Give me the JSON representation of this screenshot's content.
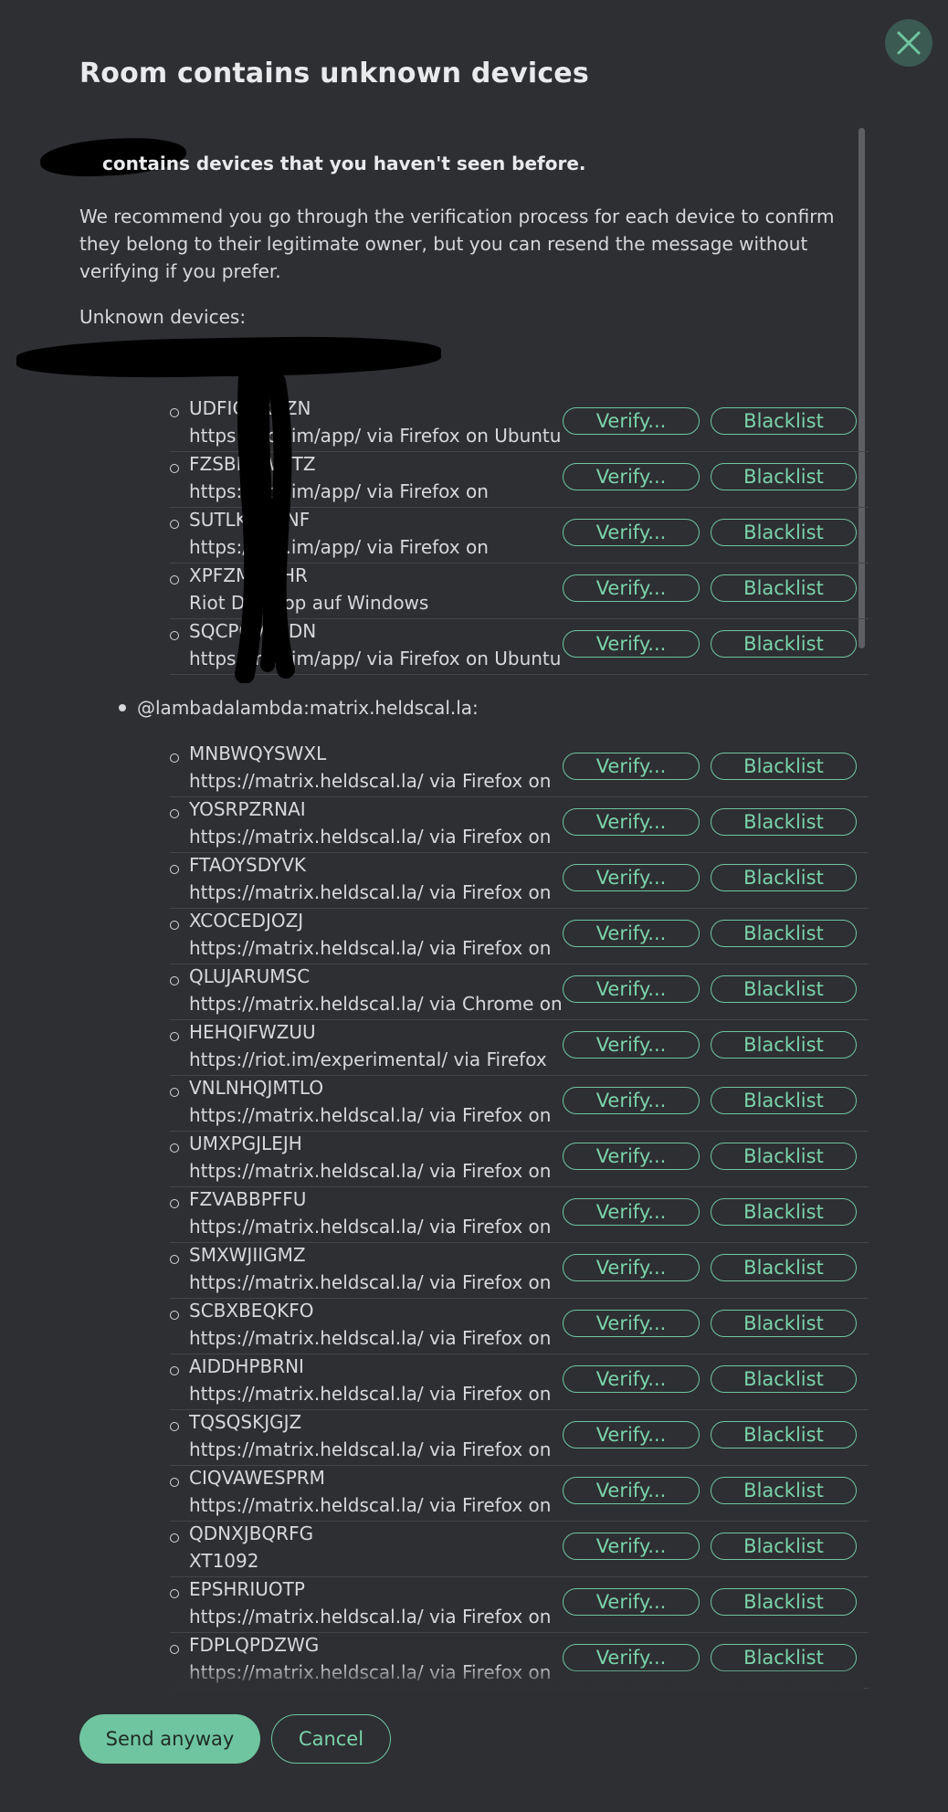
{
  "dialog": {
    "title": "Room contains unknown devices",
    "intro_strong": "contains devices that you haven't seen before.",
    "intro_desc": "We recommend you go through the verification process for each device to confirm they belong to their legitimate owner, but you can resend the message without verifying if you prefer.",
    "unknown_label": "Unknown devices:",
    "close_icon": "close-icon"
  },
  "buttons": {
    "verify": "Verify...",
    "blacklist": "Blacklist",
    "send_anyway": "Send anyway",
    "cancel": "Cancel"
  },
  "groups": [
    {
      "user": "",
      "devices": [
        {
          "id": "UDFICQRBZN",
          "desc": "https://riot.im/app/ via Firefox on Ubuntu"
        },
        {
          "id": "FZSBRKWNTZ",
          "desc": "https://riot.im/app/ via Firefox on"
        },
        {
          "id": "SUTLKGKANF",
          "desc": "https://riot.im/app/ via Firefox on"
        },
        {
          "id": "XPFZMJUTHR",
          "desc": "Riot Desktop auf Windows"
        },
        {
          "id": "SQCPOVYKDN",
          "desc": "https://riot.im/app/ via Firefox on Ubuntu"
        }
      ]
    },
    {
      "user": "@lambadalambda:matrix.heldscal.la:",
      "devices": [
        {
          "id": "MNBWQYSWXL",
          "desc": "https://matrix.heldscal.la/ via Firefox on"
        },
        {
          "id": "YOSRPZRNAI",
          "desc": "https://matrix.heldscal.la/ via Firefox on"
        },
        {
          "id": "FTAOYSDYVK",
          "desc": "https://matrix.heldscal.la/ via Firefox on"
        },
        {
          "id": "XCOCEDJOZJ",
          "desc": "https://matrix.heldscal.la/ via Firefox on"
        },
        {
          "id": "QLUJARUMSC",
          "desc": "https://matrix.heldscal.la/ via Chrome on"
        },
        {
          "id": "HEHQIFWZUU",
          "desc": "https://riot.im/experimental/ via Firefox"
        },
        {
          "id": "VNLNHQJMTLO",
          "desc": "https://matrix.heldscal.la/ via Firefox on"
        },
        {
          "id": "UMXPGJLEJH",
          "desc": "https://matrix.heldscal.la/ via Firefox on"
        },
        {
          "id": "FZVABBPFFU",
          "desc": "https://matrix.heldscal.la/ via Firefox on"
        },
        {
          "id": "SMXWJIIGMZ",
          "desc": "https://matrix.heldscal.la/ via Firefox on"
        },
        {
          "id": "SCBXBEQKFO",
          "desc": "https://matrix.heldscal.la/ via Firefox on"
        },
        {
          "id": "AIDDHPBRNI",
          "desc": "https://matrix.heldscal.la/ via Firefox on"
        },
        {
          "id": "TQSQSKJGJZ",
          "desc": "https://matrix.heldscal.la/ via Firefox on"
        },
        {
          "id": "CIQVAWESPRM",
          "desc": "https://matrix.heldscal.la/ via Firefox on"
        },
        {
          "id": "QDNXJBQRFG",
          "desc": "XT1092"
        },
        {
          "id": "EPSHRIUOTP",
          "desc": "https://matrix.heldscal.la/ via Firefox on"
        },
        {
          "id": "FDPLQPDZWG",
          "desc": "https://matrix.heldscal.la/ via Firefox on"
        }
      ]
    }
  ],
  "colors": {
    "background": "#2e2f32",
    "accent": "#6fc5a0",
    "text": "#e3e4e6"
  }
}
